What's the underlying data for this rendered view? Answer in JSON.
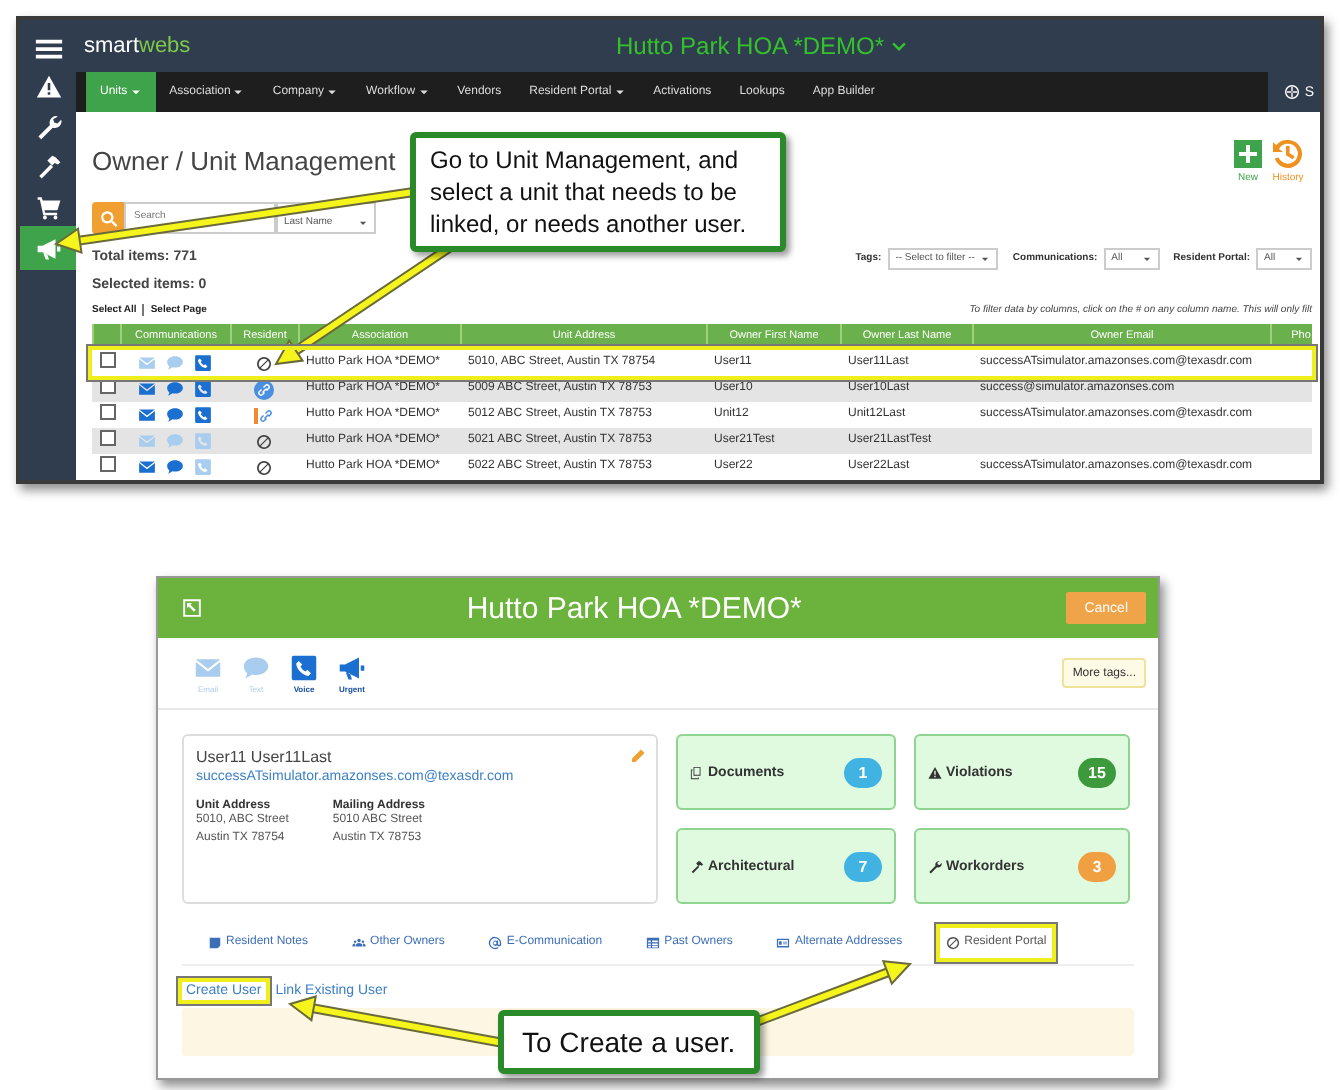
{
  "top_screen": {
    "sidebar": [
      {
        "selected": false
      },
      {
        "selected": false
      },
      {
        "selected": false
      },
      {
        "selected": false
      },
      {
        "selected": true
      }
    ],
    "logo": [
      "smart",
      "webs"
    ],
    "title": "Hutto Park HOA *DEMO*",
    "nav": [
      {
        "label": "Units",
        "selected": true,
        "dropdown": true
      },
      {
        "label": "Association",
        "selected": false,
        "dropdown": true
      },
      {
        "label": "Company",
        "selected": false,
        "dropdown": true
      },
      {
        "label": "Workflow",
        "selected": false,
        "dropdown": true
      },
      {
        "label": "Vendors",
        "selected": false,
        "dropdown": false
      },
      {
        "label": "Resident Portal",
        "selected": false,
        "dropdown": true
      },
      {
        "label": "Activations",
        "selected": false,
        "dropdown": false
      },
      {
        "label": "Lookups",
        "selected": false,
        "dropdown": false
      },
      {
        "label": "App Builder",
        "selected": false,
        "dropdown": false
      }
    ],
    "nav_right": "S",
    "page_title": "Owner / Unit Management",
    "actions": [
      {
        "label": "New",
        "kind": "new"
      },
      {
        "label": "History",
        "kind": "history"
      }
    ],
    "search": {
      "placeholder": "Search"
    },
    "sort": "Last Name",
    "total": "Total items: 771",
    "selected_count": "Selected items: 0",
    "filters": [
      {
        "label": "Tags:",
        "value": "-- Select to filter --"
      },
      {
        "label": "Communications:",
        "value": "All"
      },
      {
        "label": "Resident Portal:",
        "value": "All"
      }
    ],
    "select_all": "Select All",
    "select_page": "Select Page",
    "filter_hint": "To filter data by columns, click on the # on any column name. This will only filt",
    "columns": [
      "Communications",
      "Resident",
      "Association",
      "Unit Address",
      "Owner First Name",
      "Owner Last Name",
      "Owner Email",
      "Pho"
    ],
    "rows": [
      {
        "checked": false,
        "email": false,
        "text": false,
        "voice": true,
        "resident": {
          "kind": "none"
        },
        "association": "Hutto Park HOA *DEMO*",
        "address": "5010, ABC Street, Austin TX 78754",
        "first_name": "User11",
        "last_name": "User11Last",
        "owner_email": "successATsimulator.amazonses.com@texasdr.com",
        "highlighted": true
      },
      {
        "checked": false,
        "email": true,
        "text": true,
        "voice": true,
        "resident": {
          "kind": "linked"
        },
        "association": "Hutto Park HOA *DEMO*",
        "address": "5009 ABC Street, Austin TX 78753",
        "first_name": "User10",
        "last_name": "User10Last",
        "owner_email": "success@simulator.amazonses.com",
        "highlighted": false
      },
      {
        "checked": false,
        "email": true,
        "text": true,
        "voice": true,
        "resident": {
          "kind": "partial"
        },
        "association": "Hutto Park HOA *DEMO*",
        "address": "5012 ABC Street, Austin TX 78753",
        "first_name": "Unit12",
        "last_name": "Unit12Last",
        "owner_email": "successATsimulator.amazonses.com@texasdr.com",
        "highlighted": false
      },
      {
        "checked": false,
        "email": false,
        "text": false,
        "voice": false,
        "resident": {
          "kind": "none"
        },
        "association": "Hutto Park HOA *DEMO*",
        "address": "5021 ABC Street, Austin TX 78753",
        "first_name": "User21Test",
        "last_name": "User21LastTest",
        "highlighted": false
      },
      {
        "checked": false,
        "email": true,
        "text": true,
        "voice": false,
        "resident": {
          "kind": "none"
        },
        "association": "Hutto Park HOA *DEMO*",
        "address": "5022 ABC Street, Austin TX 78753",
        "first_name": "User22",
        "last_name": "User22Last",
        "owner_email": "successATsimulator.amazonses.com@texasdr.com",
        "highlighted": false
      }
    ]
  },
  "dialog": {
    "title": "Hutto Park HOA *DEMO*",
    "cancel": "Cancel",
    "channels": [
      {
        "label": "Email",
        "on": false
      },
      {
        "label": "Text",
        "on": false
      },
      {
        "label": "Voice",
        "on": true
      },
      {
        "label": "Urgent",
        "on": true
      }
    ],
    "more_tags": "More tags...",
    "owner": {
      "name": "User11 User11Last",
      "email": "successATsimulator.amazonses.com@texasdr.com",
      "addresses": [
        {
          "label": "Unit Address",
          "lines": [
            "5010, ABC Street",
            "Austin TX 78754"
          ]
        },
        {
          "label": "Mailing Address",
          "lines": [
            "5010 ABC Street",
            "Austin TX 78753"
          ]
        }
      ]
    },
    "tiles": [
      {
        "label": "Documents",
        "count": "1",
        "color": "#41b3e3"
      },
      {
        "label": "Violations",
        "count": "15",
        "color": "#3c9a3c"
      },
      {
        "label": "Architectural",
        "count": "7",
        "color": "#41b3e3"
      },
      {
        "label": "Workorders",
        "count": "3",
        "color": "#f0a040"
      }
    ],
    "tabs": [
      {
        "label": "Resident Notes",
        "selected": false,
        "highlighted": false
      },
      {
        "label": "Other Owners",
        "selected": false,
        "highlighted": false
      },
      {
        "label": "E-Communication",
        "selected": false,
        "highlighted": false
      },
      {
        "label": "Past Owners",
        "selected": false,
        "highlighted": false
      },
      {
        "label": "Alternate Addresses",
        "selected": false,
        "highlighted": false
      },
      {
        "label": "Resident Portal",
        "selected": true,
        "highlighted": true
      }
    ],
    "links": [
      {
        "label": "Create User",
        "highlighted": true
      },
      {
        "label": "Link Existing User",
        "highlighted": false
      }
    ]
  },
  "callouts": [
    {
      "text": "Go to Unit Management, and select a unit that needs to be linked, or needs another user."
    },
    {
      "text": "To Create a user."
    }
  ]
}
